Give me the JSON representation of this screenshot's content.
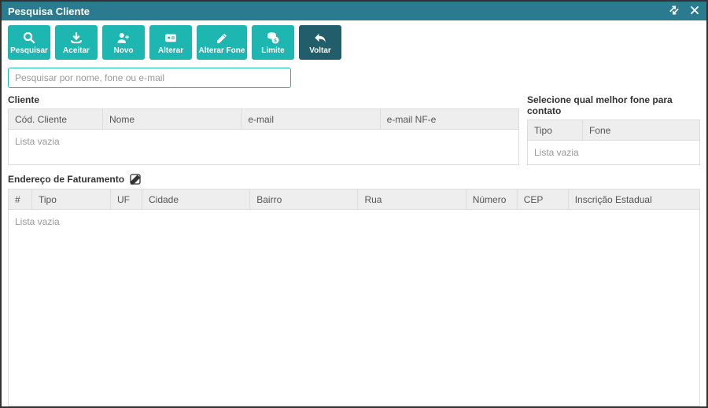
{
  "window": {
    "title": "Pesquisa Cliente"
  },
  "toolbar": {
    "pesquisar": "Pesquisar",
    "aceitar": "Aceitar",
    "novo": "Novo",
    "alterar": "Alterar",
    "alterar_fone": "Alterar Fone",
    "limite": "Limite",
    "voltar": "Voltar"
  },
  "search": {
    "placeholder": "Pesquisar por nome, fone ou e-mail",
    "value": ""
  },
  "sections": {
    "cliente": "Cliente",
    "fone_contato": "Selecione qual melhor fone para contato",
    "endereco": "Endereço de Faturamento"
  },
  "cliente_grid": {
    "columns": {
      "cod": "Cód. Cliente",
      "nome": "Nome",
      "email": "e-mail",
      "email_nfe": "e-mail NF-e"
    },
    "empty": "Lista vazia"
  },
  "fone_grid": {
    "columns": {
      "tipo": "Tipo",
      "fone": "Fone"
    },
    "empty": "Lista vazia"
  },
  "endereco_grid": {
    "columns": {
      "num": "#",
      "tipo": "Tipo",
      "uf": "UF",
      "cidade": "Cidade",
      "bairro": "Bairro",
      "rua": "Rua",
      "numero": "Número",
      "cep": "CEP",
      "inscricao": "Inscrição Estadual"
    },
    "empty": "Lista vazia"
  }
}
